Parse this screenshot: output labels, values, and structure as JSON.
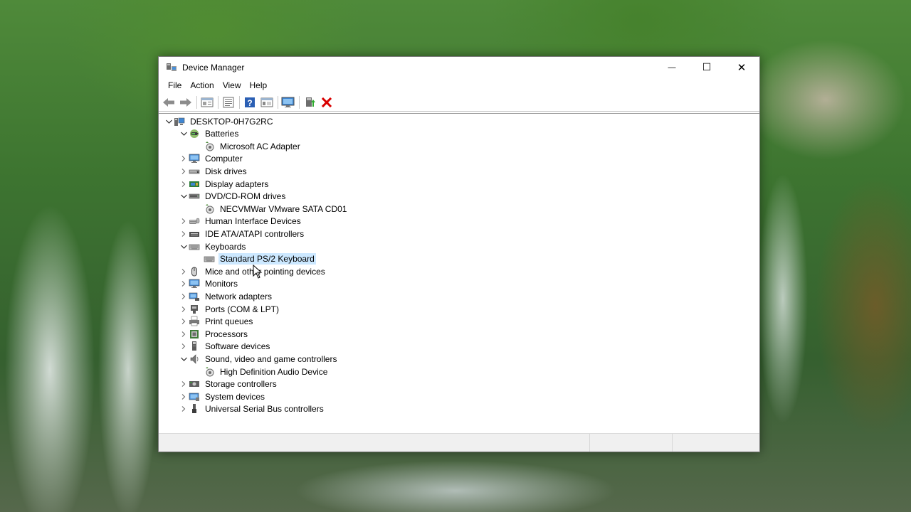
{
  "window": {
    "title": "Device Manager",
    "minimize_glyph": "—",
    "maximize_glyph": "☐",
    "close_glyph": "✕"
  },
  "menu": [
    "File",
    "Action",
    "View",
    "Help"
  ],
  "toolbar": {
    "icons": [
      "back-arrow-icon",
      "forward-arrow-icon",
      "properties-sheet-icon",
      "show-hide-tree-icon",
      "help-icon",
      "action-view-icon",
      "monitor-scan-icon",
      "update-driver-icon",
      "uninstall-x-icon"
    ],
    "delete_color": "#d80000"
  },
  "tree": {
    "root": {
      "label": "DESKTOP-0H7G2RC",
      "icon": "computer-tower-icon"
    },
    "items": [
      {
        "label": "Batteries",
        "icon": "battery-icon",
        "expanded": true,
        "children": [
          {
            "label": "Microsoft AC Adapter",
            "icon": "device-driver-icon"
          }
        ]
      },
      {
        "label": "Computer",
        "icon": "monitor-icon"
      },
      {
        "label": "Disk drives",
        "icon": "disk-drive-icon"
      },
      {
        "label": "Display adapters",
        "icon": "display-adapter-icon"
      },
      {
        "label": "DVD/CD-ROM drives",
        "icon": "dvd-drive-icon",
        "expanded": true,
        "children": [
          {
            "label": "NECVMWar VMware SATA CD01",
            "icon": "device-driver-icon"
          }
        ]
      },
      {
        "label": "Human Interface Devices",
        "icon": "hid-icon"
      },
      {
        "label": "IDE ATA/ATAPI controllers",
        "icon": "ide-controller-icon"
      },
      {
        "label": "Keyboards",
        "icon": "keyboard-icon",
        "expanded": true,
        "children": [
          {
            "label": "Standard PS/2 Keyboard",
            "icon": "keyboard-icon",
            "selected": true
          }
        ]
      },
      {
        "label": "Mice and other pointing devices",
        "icon": "mouse-icon"
      },
      {
        "label": "Monitors",
        "icon": "monitor-icon"
      },
      {
        "label": "Network adapters",
        "icon": "network-adapter-icon"
      },
      {
        "label": "Ports (COM & LPT)",
        "icon": "port-icon"
      },
      {
        "label": "Print queues",
        "icon": "printer-icon"
      },
      {
        "label": "Processors",
        "icon": "processor-icon"
      },
      {
        "label": "Software devices",
        "icon": "software-device-icon"
      },
      {
        "label": "Sound, video and game controllers",
        "icon": "speaker-icon",
        "expanded": true,
        "children": [
          {
            "label": "High Definition Audio Device",
            "icon": "device-driver-icon"
          }
        ]
      },
      {
        "label": "Storage controllers",
        "icon": "storage-controller-icon"
      },
      {
        "label": "System devices",
        "icon": "system-device-icon"
      },
      {
        "label": "Universal Serial Bus controllers",
        "icon": "usb-icon"
      }
    ]
  },
  "colors": {
    "selection": "#cce8ff",
    "window_bg": "#ffffff",
    "statusbar_bg": "#f0f0f0"
  }
}
